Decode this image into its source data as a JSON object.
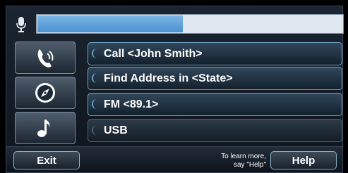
{
  "header": {
    "mic_icon": "microphone-icon",
    "progress_fraction": 0.48,
    "progress_fill_color": "#5a9ddb"
  },
  "side_buttons": [
    {
      "icon": "phone-icon"
    },
    {
      "icon": "navigation-compass-icon"
    },
    {
      "icon": "music-note-icon"
    }
  ],
  "commands": [
    {
      "label": "Call <John Smith>"
    },
    {
      "label": "Find Address in <State>"
    },
    {
      "label": "FM <89.1>"
    },
    {
      "label": "USB"
    }
  ],
  "footer": {
    "exit_label": "Exit",
    "hint_line1": "To learn more,",
    "hint_line2": "say \"Help\"",
    "help_label": "Help"
  }
}
